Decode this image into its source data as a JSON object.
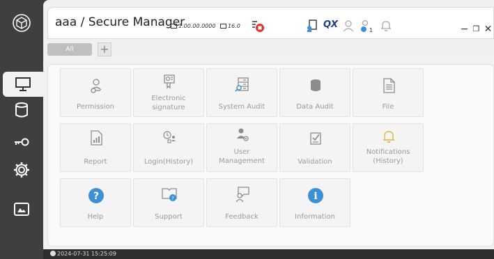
{
  "window": {
    "title": "aaa / Secure Manager",
    "meta_a": "1.00.00.0000",
    "meta_b": "16.0",
    "qx": "QX",
    "minimize": "−",
    "restore": "❐",
    "close": "✕"
  },
  "tabs": {
    "all": "All",
    "add": "+"
  },
  "tiles": [
    {
      "label": "Permission",
      "icon": "permission-icon"
    },
    {
      "label": "Electronic\nsignature",
      "icon": "signature-icon"
    },
    {
      "label": "System Audit",
      "icon": "system-audit-icon"
    },
    {
      "label": "Data Audit",
      "icon": "database-icon"
    },
    {
      "label": "File",
      "icon": "file-icon"
    },
    {
      "label": "Report",
      "icon": "report-icon"
    },
    {
      "label": "Login(History)",
      "icon": "login-history-icon"
    },
    {
      "label": "User\nManagement",
      "icon": "user-management-icon"
    },
    {
      "label": "Validation",
      "icon": "validation-icon"
    },
    {
      "label": "Notifications\n(History)",
      "icon": "bell-icon"
    },
    {
      "label": "Help",
      "icon": "help-icon"
    },
    {
      "label": "Support",
      "icon": "support-icon"
    },
    {
      "label": "Feedback",
      "icon": "feedback-icon"
    },
    {
      "label": "Information",
      "icon": "info-icon"
    }
  ],
  "status": {
    "timestamp": "2024-07-31 15:25:09"
  },
  "colors": {
    "accent_blue": "#3d8fd6",
    "icon_gray": "#8c8c8c",
    "bell": "#e0b54a",
    "red": "#d9342b"
  }
}
